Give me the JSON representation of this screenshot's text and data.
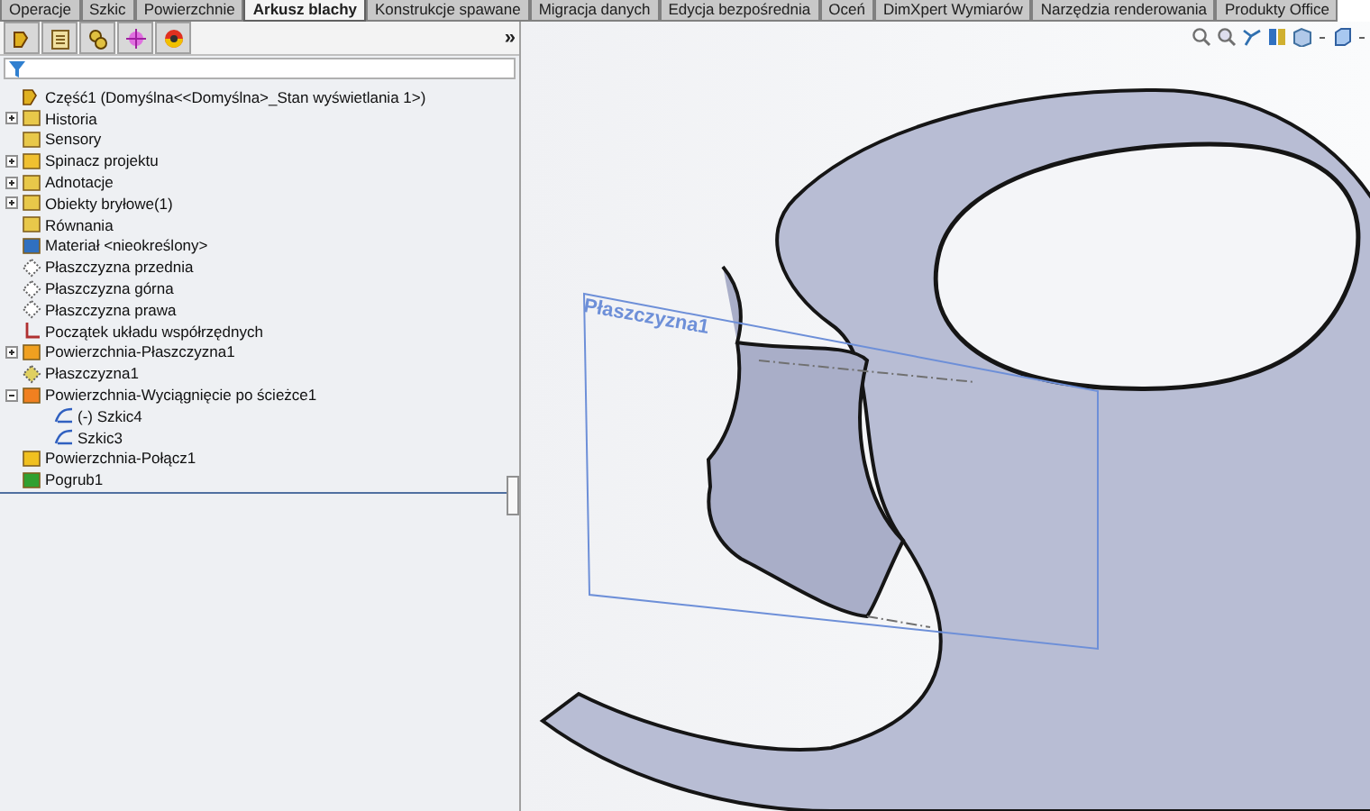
{
  "tabs": [
    {
      "label": "Operacje",
      "selected": false
    },
    {
      "label": "Szkic",
      "selected": false
    },
    {
      "label": "Powierzchnie",
      "selected": false
    },
    {
      "label": "Arkusz blachy",
      "selected": true
    },
    {
      "label": "Konstrukcje spawane",
      "selected": false
    },
    {
      "label": "Migracja danych",
      "selected": false
    },
    {
      "label": "Edycja bezpośrednia",
      "selected": false
    },
    {
      "label": "Oceń",
      "selected": false
    },
    {
      "label": "DimXpert Wymiarów",
      "selected": false
    },
    {
      "label": "Narzędzia renderowania",
      "selected": false
    },
    {
      "label": "Produkty Office",
      "selected": false
    }
  ],
  "panel": {
    "expand_glyph": "»",
    "root": {
      "label": "Część1  (Domyślna<<Domyślna>_Stan wyświetlania 1>)"
    },
    "tree": [
      {
        "label": "Historia",
        "kind": "history",
        "expanded": false
      },
      {
        "label": "Sensory",
        "kind": "sensor"
      },
      {
        "label": "Spinacz projektu",
        "kind": "binder",
        "expanded": false
      },
      {
        "label": "Adnotacje",
        "kind": "annotation",
        "expanded": false
      },
      {
        "label": "Obiekty bryłowe(1)",
        "kind": "bodies",
        "expanded": false
      },
      {
        "label": "Równania",
        "kind": "equation"
      },
      {
        "label": "Materiał <nieokreślony>",
        "kind": "material"
      },
      {
        "label": "Płaszczyzna przednia",
        "kind": "plane"
      },
      {
        "label": "Płaszczyzna górna",
        "kind": "plane"
      },
      {
        "label": "Płaszczyzna prawa",
        "kind": "plane"
      },
      {
        "label": "Początek układu współrzędnych",
        "kind": "origin"
      },
      {
        "label": "Powierzchnia-Płaszczyzna1",
        "kind": "surface",
        "expanded": false
      },
      {
        "label": "Płaszczyzna1",
        "kind": "refplane"
      },
      {
        "label": "Powierzchnia-Wyciągnięcie po ścieżce1",
        "kind": "sweep",
        "expanded": true,
        "children": [
          {
            "label": "(-) Szkic4",
            "kind": "sketch"
          },
          {
            "label": "Szkic3",
            "kind": "sketch"
          }
        ]
      },
      {
        "label": "Powierzchnia-Połącz1",
        "kind": "knit"
      },
      {
        "label": "Pogrub1",
        "kind": "thicken"
      }
    ]
  },
  "viewport": {
    "plane_label": "Płaszczyzna1"
  }
}
